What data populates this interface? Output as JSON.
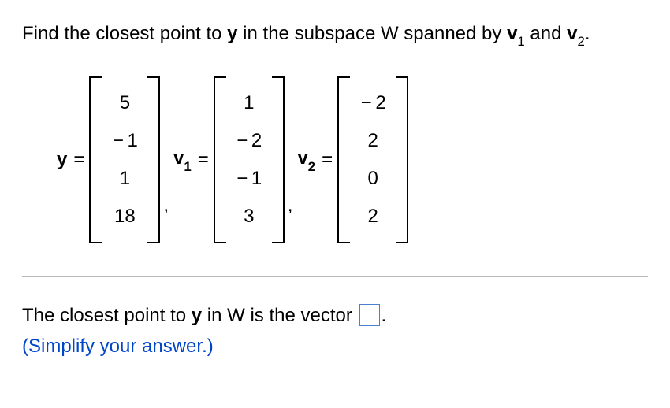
{
  "question": {
    "prefix": "Find the closest point to ",
    "y": "y",
    "mid1": " in the subspace W spanned by ",
    "v1": "v",
    "v1_sub": "1",
    "and": " and ",
    "v2": "v",
    "v2_sub": "2",
    "suffix": "."
  },
  "vectors": {
    "y_label": "y",
    "v1_label": "v",
    "v1_sub": "1",
    "v2_label": "v",
    "v2_sub": "2",
    "eq": "=",
    "comma": ",",
    "y": [
      "5",
      "− 1",
      "1",
      "18"
    ],
    "v1": [
      "1",
      "− 2",
      "− 1",
      "3"
    ],
    "v2": [
      "− 2",
      "2",
      "0",
      "2"
    ]
  },
  "answer": {
    "prefix": "The closest point to ",
    "y": "y",
    "mid": " in W is the vector ",
    "period": ".",
    "simplify": "(Simplify your answer.)"
  },
  "chart_data": {
    "type": "table",
    "description": "Column vectors for orthogonal projection problem",
    "vectors": {
      "y": [
        5,
        -1,
        1,
        18
      ],
      "v1": [
        1,
        -2,
        -1,
        3
      ],
      "v2": [
        -2,
        2,
        0,
        2
      ]
    }
  }
}
